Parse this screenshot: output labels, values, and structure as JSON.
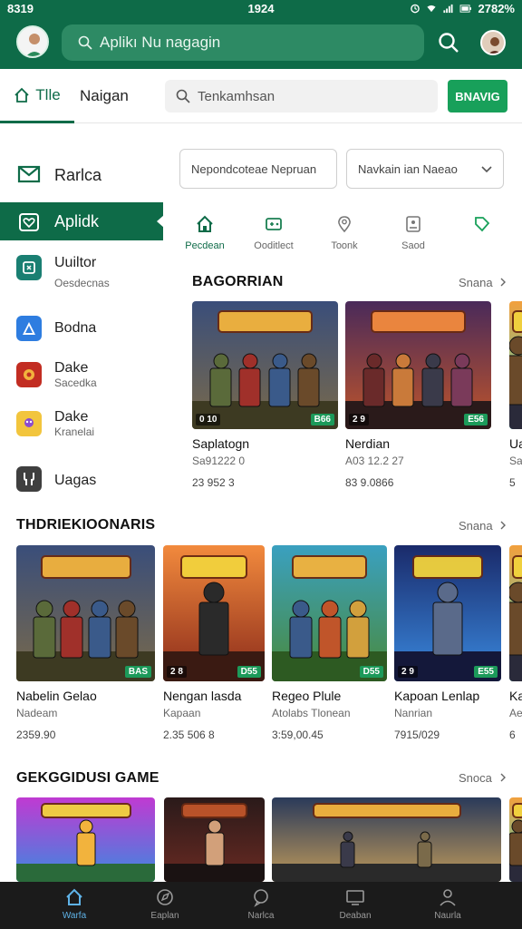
{
  "status_bar": {
    "time_left": "8319",
    "time_center": "1924",
    "battery": "2782%"
  },
  "app_bar": {
    "search_placeholder": "Aplikı Nu nagagin"
  },
  "toolbar": {
    "home_tab": "Tlle",
    "nav_tab": "Naigan",
    "search_placeholder": "Tenkamhsan",
    "button_label": "BNAVIG"
  },
  "sidebar": {
    "items": [
      {
        "icon": "mail-icon",
        "label": "Rarlca",
        "sub": ""
      },
      {
        "icon": "heart-icon",
        "label": "Aplidk",
        "sub": ""
      },
      {
        "icon": "app-icon",
        "label": "Uuiltor",
        "sub": "Oesdecnas"
      },
      {
        "icon": "app-icon",
        "label": "Bodna",
        "sub": ""
      },
      {
        "icon": "app-icon",
        "label": "Dake",
        "sub": "Sacedka"
      },
      {
        "icon": "app-icon",
        "label": "Dake",
        "sub": "Kranelai"
      },
      {
        "icon": "wrench-icon",
        "label": "Uagas",
        "sub": ""
      }
    ]
  },
  "filters": {
    "left": "Nepondcoteae Nepruan",
    "right": "Navkain ian Naeao"
  },
  "categories": [
    {
      "label": "Pecdean",
      "icon": "home-icon"
    },
    {
      "label": "Ooditlect",
      "icon": "gamepad-icon"
    },
    {
      "label": "Toonk",
      "icon": "location-icon"
    },
    {
      "label": "Saod",
      "icon": "card-icon"
    },
    {
      "label": "",
      "icon": "tag-icon"
    }
  ],
  "sections": [
    {
      "title": "BAGORRIAN",
      "more": "Snana",
      "cards": [
        {
          "name": "Saplatogn",
          "sub": "Sa91222 0",
          "num": "23 952 3",
          "badge_l": "0 10",
          "badge_r": "B66",
          "theme": "squad"
        },
        {
          "name": "Nerdian",
          "sub": "A03 12.2 27",
          "num": "83 9.0866",
          "badge_l": "2 9",
          "badge_r": "E56",
          "theme": "warrior"
        },
        {
          "name": "Ua",
          "sub": "Sa",
          "num": "5",
          "badge_l": "",
          "badge_r": "",
          "theme": "neon"
        }
      ]
    },
    {
      "title": "THDRIEKIOONARIS",
      "more": "Snana",
      "cards": [
        {
          "name": "Nabelin Gelao",
          "sub": "Nadeam",
          "num": "2359.90",
          "badge_l": "",
          "badge_r": "BAS",
          "theme": "squad"
        },
        {
          "name": "Nengan lasda",
          "sub": "Kapaan",
          "num": "2.35 506 8",
          "badge_l": "2 8",
          "badge_r": "D55",
          "theme": "hero"
        },
        {
          "name": "Regeo Plule",
          "sub": "Atolabs Tlonean",
          "num": "3:59,00.45",
          "badge_l": "",
          "badge_r": "D55",
          "theme": "jungle"
        },
        {
          "name": "Kapoan Lenlap",
          "sub": "Nanrian",
          "num": "7915/029",
          "badge_l": "2 9",
          "badge_r": "E55",
          "theme": "blue"
        },
        {
          "name": "Ka",
          "sub": "Ae",
          "num": "6",
          "badge_l": "",
          "badge_r": "",
          "theme": "neon"
        }
      ]
    },
    {
      "title": "GEKGGIDUSI GAME",
      "more": "Snoca",
      "cards": [
        {
          "theme": "cartoon"
        },
        {
          "theme": "portrait"
        },
        {
          "theme": "knight"
        },
        {
          "theme": "neon"
        }
      ]
    }
  ],
  "bottom_nav": [
    {
      "label": "Warfa",
      "icon": "home-icon"
    },
    {
      "label": "Eaplan",
      "icon": "compass-icon"
    },
    {
      "label": "Narlca",
      "icon": "chat-icon"
    },
    {
      "label": "Deaban",
      "icon": "screen-icon"
    },
    {
      "label": "Naurla",
      "icon": "user-icon"
    }
  ],
  "colors": {
    "brand": "#0e6b48",
    "accent": "#18a05a",
    "badge": "#1c9a5a",
    "nav_active": "#5fb3e8"
  }
}
